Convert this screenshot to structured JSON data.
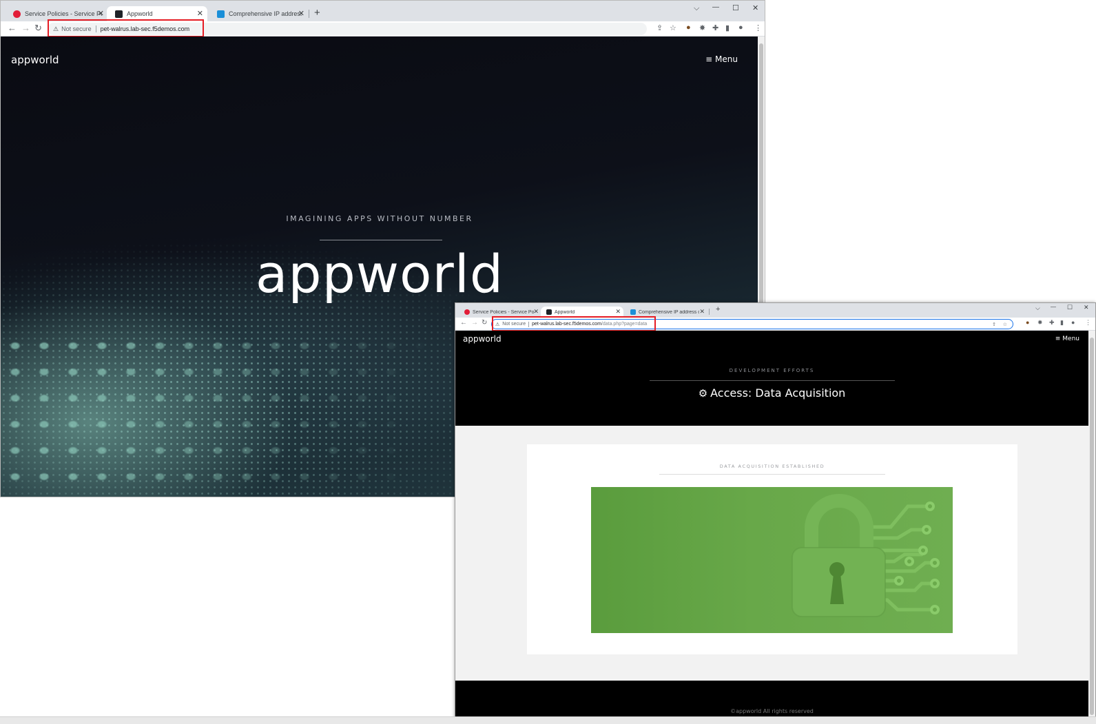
{
  "window1": {
    "tabs": [
      {
        "title": "Service Policies - Service Policies",
        "close": "✕"
      },
      {
        "title": "Appworld",
        "close": "✕"
      },
      {
        "title": "Comprehensive IP address data, IP",
        "close": "✕"
      }
    ],
    "new_tab": "+",
    "window_controls": {
      "dropdown": "⌵",
      "minimize": "—",
      "maximize": "☐",
      "close": "✕"
    },
    "address": {
      "security": "Not secure",
      "host": "pet-walrus.lab-sec.f5demos.com",
      "path": ""
    },
    "page": {
      "logo": "appworld",
      "menu": "≡ Menu",
      "tagline": "IMAGINING APPS WITHOUT NUMBER",
      "hero": "appworld"
    }
  },
  "window2": {
    "tabs": [
      {
        "title": "Service Policies - Service Policies",
        "close": "✕"
      },
      {
        "title": "Appworld",
        "close": "✕"
      },
      {
        "title": "Comprehensive IP address data, IP",
        "close": "✕"
      }
    ],
    "new_tab": "+",
    "window_controls": {
      "dropdown": "⌵",
      "minimize": "—",
      "maximize": "☐",
      "close": "✕"
    },
    "address": {
      "security": "Not secure",
      "host": "pet-walrus.lab-sec.f5demos.com",
      "path": "/data.php?page=data"
    },
    "page": {
      "logo": "appworld",
      "menu": "≡ Menu",
      "kicker": "DEVELOPMENT EFFORTS",
      "title_icon": "⚙",
      "title": "Access: Data Acquisition",
      "card_kicker": "DATA ACQUISITION ESTABLISHED",
      "footer": "©appworld All rights reserved"
    }
  },
  "colors": {
    "highlight_box": "#e51b23",
    "lock_green": "#68a849",
    "header_black": "#000000"
  }
}
